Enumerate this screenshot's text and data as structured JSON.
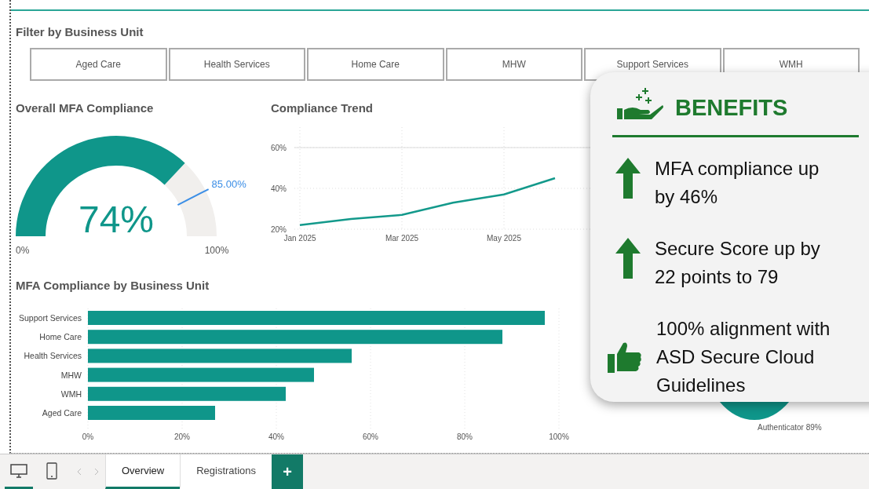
{
  "filter": {
    "title": "Filter by Business Unit",
    "buttons": [
      "Aged Care",
      "Health Services",
      "Home Care",
      "MHW",
      "Support Services",
      "WMH"
    ]
  },
  "gauge": {
    "title": "Overall MFA Compliance",
    "value_label": "74%",
    "target_label": "85.00%",
    "min_label": "0%",
    "max_label": "100%"
  },
  "trend": {
    "title": "Compliance Trend",
    "chart_data": {
      "type": "line",
      "categories": [
        "Jan 2025",
        null,
        "Mar 2025",
        null,
        "May 2025",
        null
      ],
      "grid": true,
      "series": [
        {
          "color": "#13998b",
          "values": [
            22,
            25,
            27,
            33,
            37,
            45
          ]
        }
      ],
      "ylim": [
        20,
        60
      ],
      "yticks": [
        {
          "value": 20,
          "label": "20%"
        },
        {
          "value": 40,
          "label": "40%"
        },
        {
          "value": 60,
          "label": "60%"
        }
      ]
    }
  },
  "bar_chart": {
    "title": "MFA Compliance by Business Unit",
    "chart_data": {
      "type": "bar",
      "orientation": "horizontal",
      "categories": [
        "Support Services",
        "Home Care",
        "Health Services",
        "MHW",
        "WMH",
        "Aged Care"
      ],
      "grid": true,
      "series": [
        {
          "color": "#0f968a",
          "values": [
            97,
            88,
            56,
            48,
            42,
            27
          ]
        }
      ],
      "xlim": [
        0,
        100
      ],
      "xticks": [
        {
          "value": 0,
          "label": "0%"
        },
        {
          "value": 20,
          "label": "20%"
        },
        {
          "value": 40,
          "label": "40%"
        },
        {
          "value": 60,
          "label": "60%"
        },
        {
          "value": 80,
          "label": "80%"
        },
        {
          "value": 100,
          "label": "100%"
        }
      ]
    }
  },
  "donut_label": "Authenticator 89%",
  "benefits": {
    "title": "BENEFITS",
    "items": [
      {
        "kind": "up",
        "text": "MFA compliance up by 46%"
      },
      {
        "kind": "up",
        "text": "Secure Score up by 22 points to 79"
      },
      {
        "kind": "thumb",
        "text": "100% alignment with ASD Secure Cloud Guidelines"
      }
    ]
  },
  "view_modes": [
    {
      "kind": "desktop",
      "selected": true
    },
    {
      "kind": "mobile",
      "selected": false
    }
  ],
  "page_tabs": [
    {
      "label": "Overview",
      "selected": true
    },
    {
      "label": "Registrations",
      "selected": false
    }
  ],
  "add_page_button": "+"
}
